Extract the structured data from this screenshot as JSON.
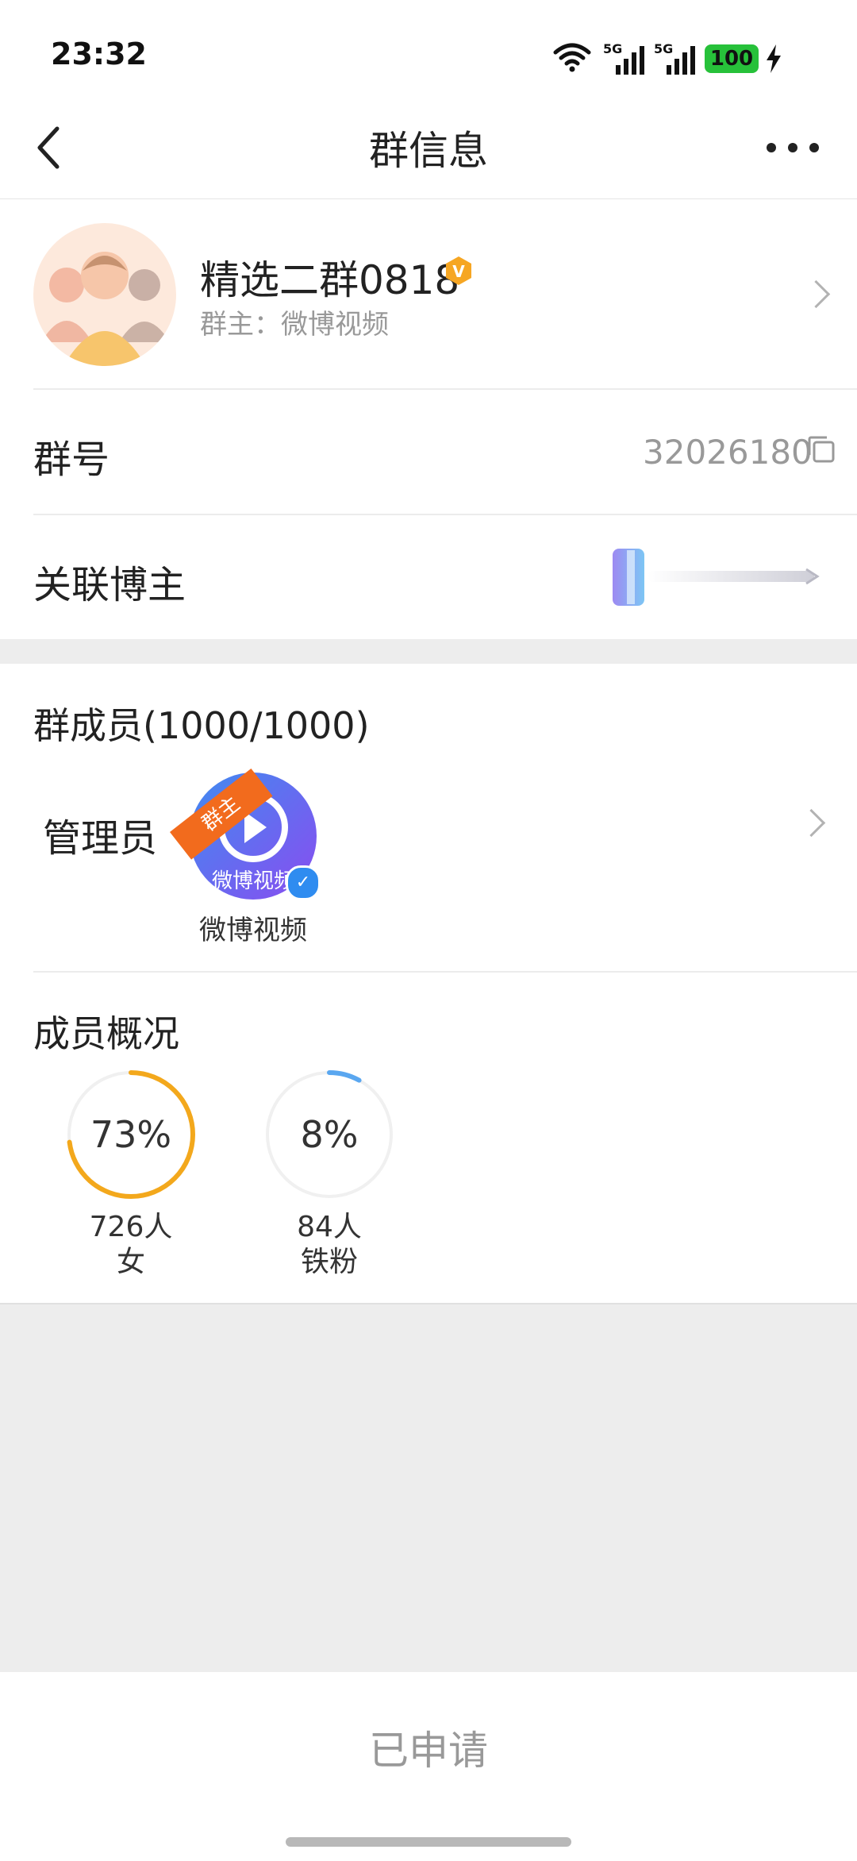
{
  "status_bar": {
    "time": "23:32",
    "net1": "5G",
    "net2": "5G",
    "battery": "100"
  },
  "nav": {
    "title": "群信息"
  },
  "group": {
    "name": "精选二群0818",
    "owner_line": "群主：微博视频",
    "verified_badge": "V"
  },
  "group_number": {
    "label": "群号",
    "value": "32026180"
  },
  "linked_blogger": {
    "label": "关联博主"
  },
  "members": {
    "title": "群成员(1000/1000)",
    "admin_label": "管理员",
    "owner_tag": "群主",
    "admin_name": "微博视频",
    "avatar_text": "微博视频"
  },
  "overview": {
    "title": "成员概况",
    "stats": [
      {
        "percent_text": "73%",
        "percent": 0.73,
        "count": "726人",
        "category": "女",
        "color": "#f3a81c"
      },
      {
        "percent_text": "8%",
        "percent": 0.08,
        "count": "84人",
        "category": "铁粉",
        "color": "#5aa7f0"
      }
    ]
  },
  "bottom": {
    "apply_label": "已申请"
  },
  "colors": {
    "accent_orange": "#f3a81c",
    "accent_blue": "#5aa7f0",
    "battery_green": "#27c13a"
  }
}
